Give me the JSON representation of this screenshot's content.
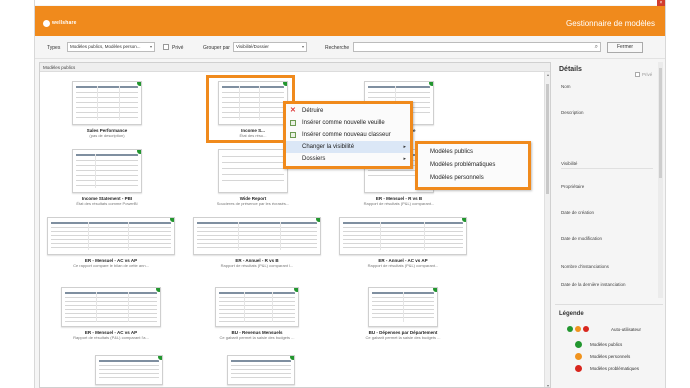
{
  "window": {
    "close_glyph": "×"
  },
  "header": {
    "logo_text": "wellshare",
    "title": "Gestionnaire de modèles",
    "accent": "#f08a1c"
  },
  "toolbar": {
    "types_label": "Types",
    "types_value": "Modèles publics, Modèles person...",
    "prive_label": "Privé",
    "group_label": "Grouper par",
    "group_value": "Visibilité/Dossier",
    "search_label": "Recherche",
    "search_placeholder": "",
    "close_button": "Fermer"
  },
  "gallery": {
    "section_title": "Modèles publics",
    "tiles": [
      {
        "title": "Sales Performance",
        "subtitle": "(pas de description)"
      },
      {
        "title": "Income S...",
        "subtitle": "État des résu..."
      },
      {
        "title": "...tput Template",
        "subtitle": "...cription)"
      },
      {
        "title": "Income Statement - PBI",
        "subtitle": "État des résultats comme PowerBI"
      },
      {
        "title": "Wide Report",
        "subtitle": "Soucieres de présence par les écrasés..."
      },
      {
        "title": "ER - Mensuel - R vs B",
        "subtitle": "Rapport de résultats (P&L) comparant..."
      },
      {
        "title": "ER - Mensuel - AC vs AP",
        "subtitle": "Ce rapport compare le bilan de cette ann..."
      },
      {
        "title": "ER - Annuel - R vs B",
        "subtitle": "Rapport de résultats (P&L) comparant l..."
      },
      {
        "title": "ER - Annuel - AC vs AP",
        "subtitle": "Rapport de résultats (P&L) comparant..."
      },
      {
        "title": "ER - Mensuel - AC vs AP",
        "subtitle": "Rapport de résultats (P&L) comparant l'a..."
      },
      {
        "title": "BU - Revenus Mensuels",
        "subtitle": "Ce gabarit permet la saisie des budgets ..."
      },
      {
        "title": "BU - Dépenses par Département",
        "subtitle": "Ce gabarit permet la saisie des budgets ..."
      }
    ]
  },
  "context_menu": {
    "items": [
      {
        "label": "Détruire",
        "icon": "delete-icon"
      },
      {
        "label": "Insérer comme nouvelle veuille",
        "icon": "sheet-icon"
      },
      {
        "label": "Insérer comme nouveau classeur",
        "icon": "workbook-icon"
      },
      {
        "label": "Changer la visibilité",
        "arrow": "▸"
      },
      {
        "label": "Dossiers",
        "arrow": "▸"
      }
    ]
  },
  "submenu": {
    "items": [
      "Modèles publics",
      "Modèles problématiques",
      "Modèles personnels"
    ]
  },
  "details": {
    "title": "Détails",
    "prive_label": "Privé",
    "fields": [
      "Nom",
      "Description",
      "Visibilité",
      "Propriétaire",
      "Date de création",
      "Date de modification",
      "Nombre d'instanciations",
      "Date de la dernière instanciation"
    ]
  },
  "legend": {
    "title": "Légende",
    "auto_label": "Auto-utilisateur",
    "items": [
      {
        "label": "Modèles publics",
        "color": "#22962f"
      },
      {
        "label": "Modèles personnels",
        "color": "#f0931e"
      },
      {
        "label": "Modèles problématiques",
        "color": "#d8261e"
      }
    ]
  }
}
